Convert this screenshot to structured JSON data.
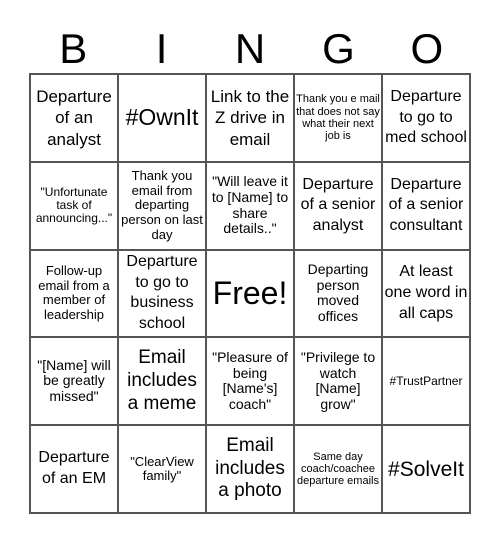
{
  "header": {
    "letters": [
      "B",
      "I",
      "N",
      "G",
      "O"
    ]
  },
  "cells": [
    "Departure of an analyst",
    "#OwnIt",
    "Link to the Z drive in email",
    "Thank you e mail that does not say what their next job is",
    "Departure to go to med school",
    "\"Unfortunate task of announcing...\"",
    "Thank you email from departing person on last day",
    "\"Will leave it to [Name] to share details..\"",
    "Departure of a senior analyst",
    "Departure of a senior consultant",
    "Follow-up email from a member of leadership",
    "Departure to go to business school",
    "Free!",
    "Departing person moved offices",
    "At least one word in all caps",
    "\"[Name] will be greatly missed\"",
    "Email includes a meme",
    "\"Pleasure of being [Name's] coach\"",
    "\"Privilege to watch [Name] grow\"",
    "#TrustPartner",
    "Departure of an EM",
    "\"ClearView family\"",
    "Email includes a photo",
    "Same day coach/coachee departure emails",
    "#SolveIt"
  ]
}
